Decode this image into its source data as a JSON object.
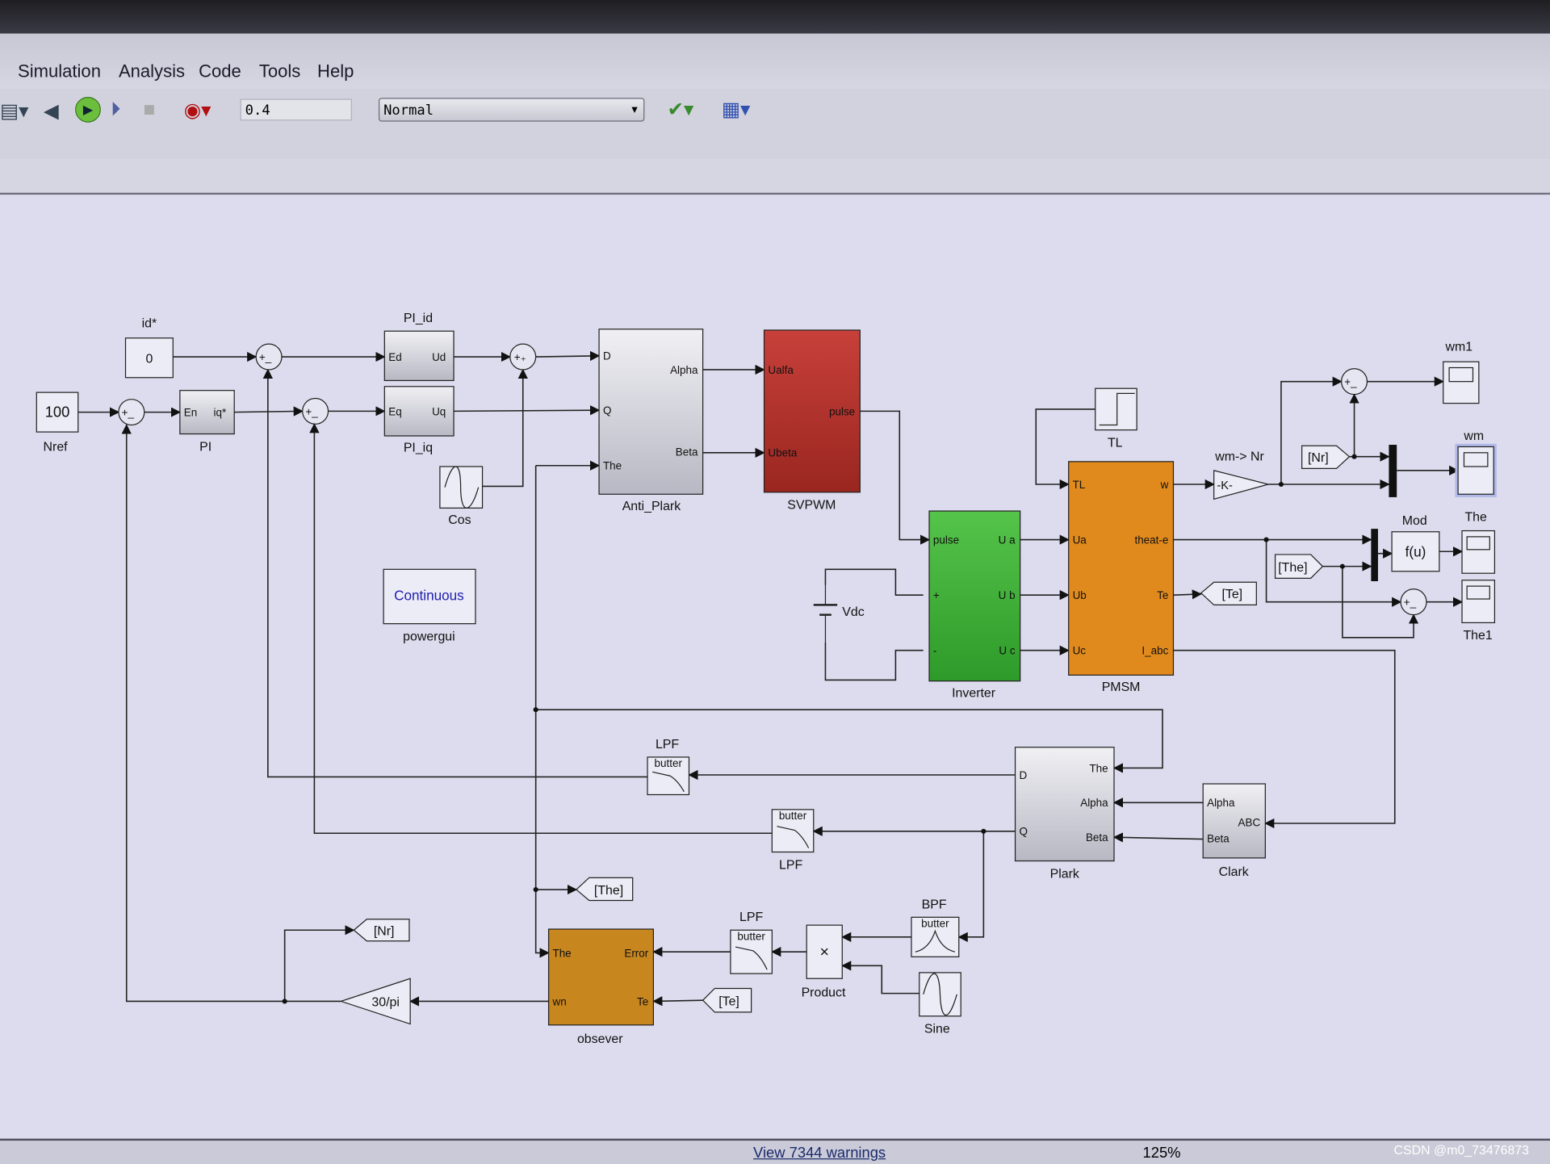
{
  "menu": [
    "Simulation",
    "Analysis",
    "Code",
    "Tools",
    "Help"
  ],
  "toolbar": {
    "stop_time": "0.4",
    "sim_mode": "Normal",
    "icons": [
      "library-icon",
      "step-back-icon",
      "run-icon",
      "step-forward-icon",
      "stop-icon",
      "record-icon",
      "check-icon",
      "build-icon"
    ]
  },
  "status": {
    "warnings": "View 7344 warnings",
    "zoom": "125%",
    "watermark": "CSDN @m0_73476873"
  },
  "blocks": {
    "nref": {
      "value": "100",
      "label": "Nref"
    },
    "id_ref": {
      "value": "0",
      "label": "id*"
    },
    "pi": {
      "label": "PI",
      "ports": [
        "En",
        "iq*"
      ]
    },
    "pi_id": {
      "label": "PI_id",
      "ports": [
        "Ed",
        "Ud"
      ]
    },
    "pi_iq": {
      "label": "PI_iq",
      "ports": [
        "Eq",
        "Uq"
      ]
    },
    "cos": {
      "label": "Cos"
    },
    "anti_park": {
      "label": "Anti_Plark",
      "ports": [
        "D",
        "Q",
        "The",
        "Alpha",
        "Beta"
      ]
    },
    "svpwm": {
      "label": "SVPWM",
      "ports": [
        "Ualfa",
        "Ubeta",
        "pulse"
      ]
    },
    "powergui": {
      "value": "Continuous",
      "label": "powergui"
    },
    "vdc": {
      "label": "Vdc"
    },
    "inverter": {
      "label": "Inverter",
      "ports": [
        "pulse",
        "+",
        "-",
        "U a",
        "U b",
        "U c"
      ]
    },
    "tl": {
      "label": "TL"
    },
    "pmsm": {
      "label": "PMSM",
      "ports": [
        "TL",
        "Ua",
        "Ub",
        "Uc",
        "w",
        "theat-e",
        "Te",
        "I_abc"
      ]
    },
    "gain_nr": {
      "value": "-K-",
      "label": "wm-> Nr"
    },
    "goto_nr_in": {
      "value": "[Nr]"
    },
    "scope_wm1": {
      "label": "wm1"
    },
    "scope_wm": {
      "label": "wm"
    },
    "mod": {
      "value": "f(u)",
      "label": "Mod"
    },
    "scope_the": {
      "label": "The"
    },
    "scope_the1": {
      "label": "The1"
    },
    "from_the": {
      "value": "[The]"
    },
    "goto_te": {
      "value": "[Te]"
    },
    "park": {
      "label": "Plark",
      "ports": [
        "D",
        "Q",
        "The",
        "Alpha",
        "Beta"
      ]
    },
    "clark": {
      "label": "Clark",
      "ports": [
        "Alpha",
        "Beta",
        "ABC"
      ]
    },
    "lpf1": {
      "value": "butter",
      "label": "LPF"
    },
    "lpf2": {
      "value": "butter",
      "label": "LPF"
    },
    "lpf3": {
      "value": "butter",
      "label": "LPF"
    },
    "bpf": {
      "value": "butter",
      "label": "BPF"
    },
    "product": {
      "value": "×",
      "label": "Product"
    },
    "sine": {
      "label": "Sine"
    },
    "goto_the": {
      "value": "[The]"
    },
    "observer": {
      "label": "obsever",
      "ports": [
        "The",
        "Error",
        "wn",
        "Te"
      ]
    },
    "from_te": {
      "value": "[Te]"
    },
    "gain_30pi": {
      "value": "30/pi"
    },
    "goto_nr": {
      "value": "[Nr]"
    },
    "sum_signs": "+_"
  },
  "colors": {
    "svpwm": "#b3322b",
    "inverter": "#3fae3a",
    "pmsm": "#e08a1e",
    "observer": "#c8861f",
    "canvas": "#dcdcee"
  }
}
